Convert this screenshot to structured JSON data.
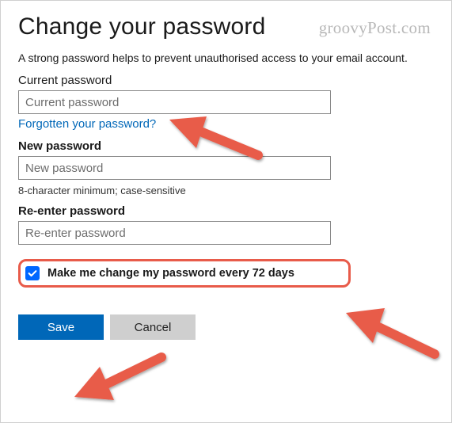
{
  "watermark": "groovyPost.com",
  "heading": "Change your password",
  "description": "A strong password helps to prevent unauthorised access to your email account.",
  "current": {
    "label": "Current password",
    "placeholder": "Current password",
    "forgot_link": "Forgotten your password?"
  },
  "newpw": {
    "label": "New password",
    "placeholder": "New password",
    "hint": "8-character minimum; case-sensitive"
  },
  "reenter": {
    "label": "Re-enter password",
    "placeholder": "Re-enter password"
  },
  "force_change": {
    "checked": true,
    "label": "Make me change my password every 72 days"
  },
  "buttons": {
    "save": "Save",
    "cancel": "Cancel"
  }
}
